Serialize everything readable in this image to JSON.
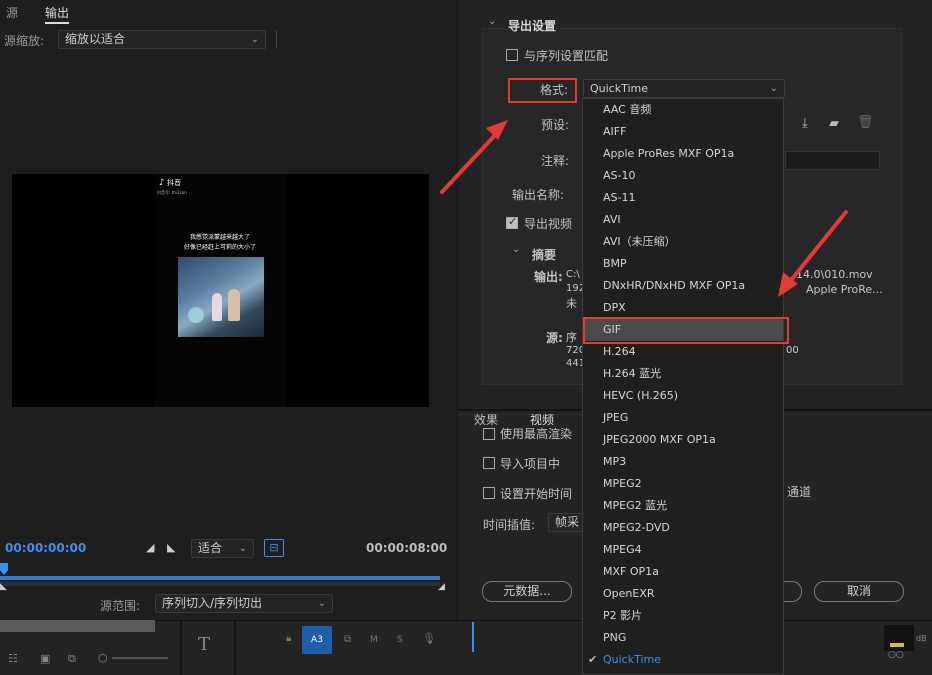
{
  "source_monitor": {
    "tabs": [
      "源",
      "输出"
    ],
    "source_zoom_label": "源缩放:",
    "source_zoom_value": "缩放以适合",
    "video_overlay": {
      "logo_text": "抖音",
      "id_text": "抖音号: ttv2san",
      "line1": "我感觉派蒙越来越大了",
      "line2": "好像已经赶上可莉的大小了"
    },
    "timecode_in": "00:00:00:00",
    "fit_value": "适合",
    "timecode_duration": "00:00:08:00",
    "source_range_label": "源范围:",
    "source_range_value": "序列切入/序列切出"
  },
  "export_settings": {
    "section_title": "导出设置",
    "match_sequence_label": "与序列设置匹配",
    "format_label": "格式:",
    "format_value": "QuickTime",
    "preset_label": "预设:",
    "comment_label": "注释:",
    "output_name_label": "输出名称:",
    "export_video_label": "导出视频",
    "summary_title": "摘要",
    "output_label": "输出:",
    "output_partial_1": "C:\\",
    "output_partial_2": "192",
    "output_partial_3": "未",
    "output_file_fragment": "14.0\\010.mov",
    "output_codec_fragment": "Apple ProRe...",
    "source_label": "源:",
    "source_partial_1": "序",
    "source_partial_2": "720",
    "source_partial_3": "441",
    "source_fragment": "00"
  },
  "lower_tabs": [
    "效果",
    "视频"
  ],
  "options": {
    "max_render_label": "使用最高渲染",
    "import_project_label": "导入项目中",
    "start_time_label": "设置开始时间",
    "channel_fragment": "通道",
    "time_interp_label": "时间插值:",
    "time_interp_value": "帧采"
  },
  "buttons": {
    "metadata": "元数据...",
    "cancel": "取消"
  },
  "format_list": {
    "items": [
      "AAC 音频",
      "AIFF",
      "Apple ProRes MXF OP1a",
      "AS-10",
      "AS-11",
      "AVI",
      "AVI（未压缩）",
      "BMP",
      "DNxHR/DNxHD MXF OP1a",
      "DPX",
      "GIF",
      "H.264",
      "H.264 蓝光",
      "HEVC (H.265)",
      "JPEG",
      "JPEG2000 MXF OP1a",
      "MP3",
      "MPEG2",
      "MPEG2 蓝光",
      "MPEG2-DVD",
      "MPEG4",
      "MXF OP1a",
      "OpenEXR",
      "P2 影片",
      "PNG",
      "QuickTime"
    ],
    "highlighted": "GIF",
    "selected": "QuickTime"
  },
  "timeline": {
    "track_label": "A3",
    "track_m": "M",
    "track_s": "S",
    "db_label": "dB"
  },
  "colors": {
    "accent_blue": "#3d8fe8",
    "annotation_red": "#e23a3a"
  }
}
